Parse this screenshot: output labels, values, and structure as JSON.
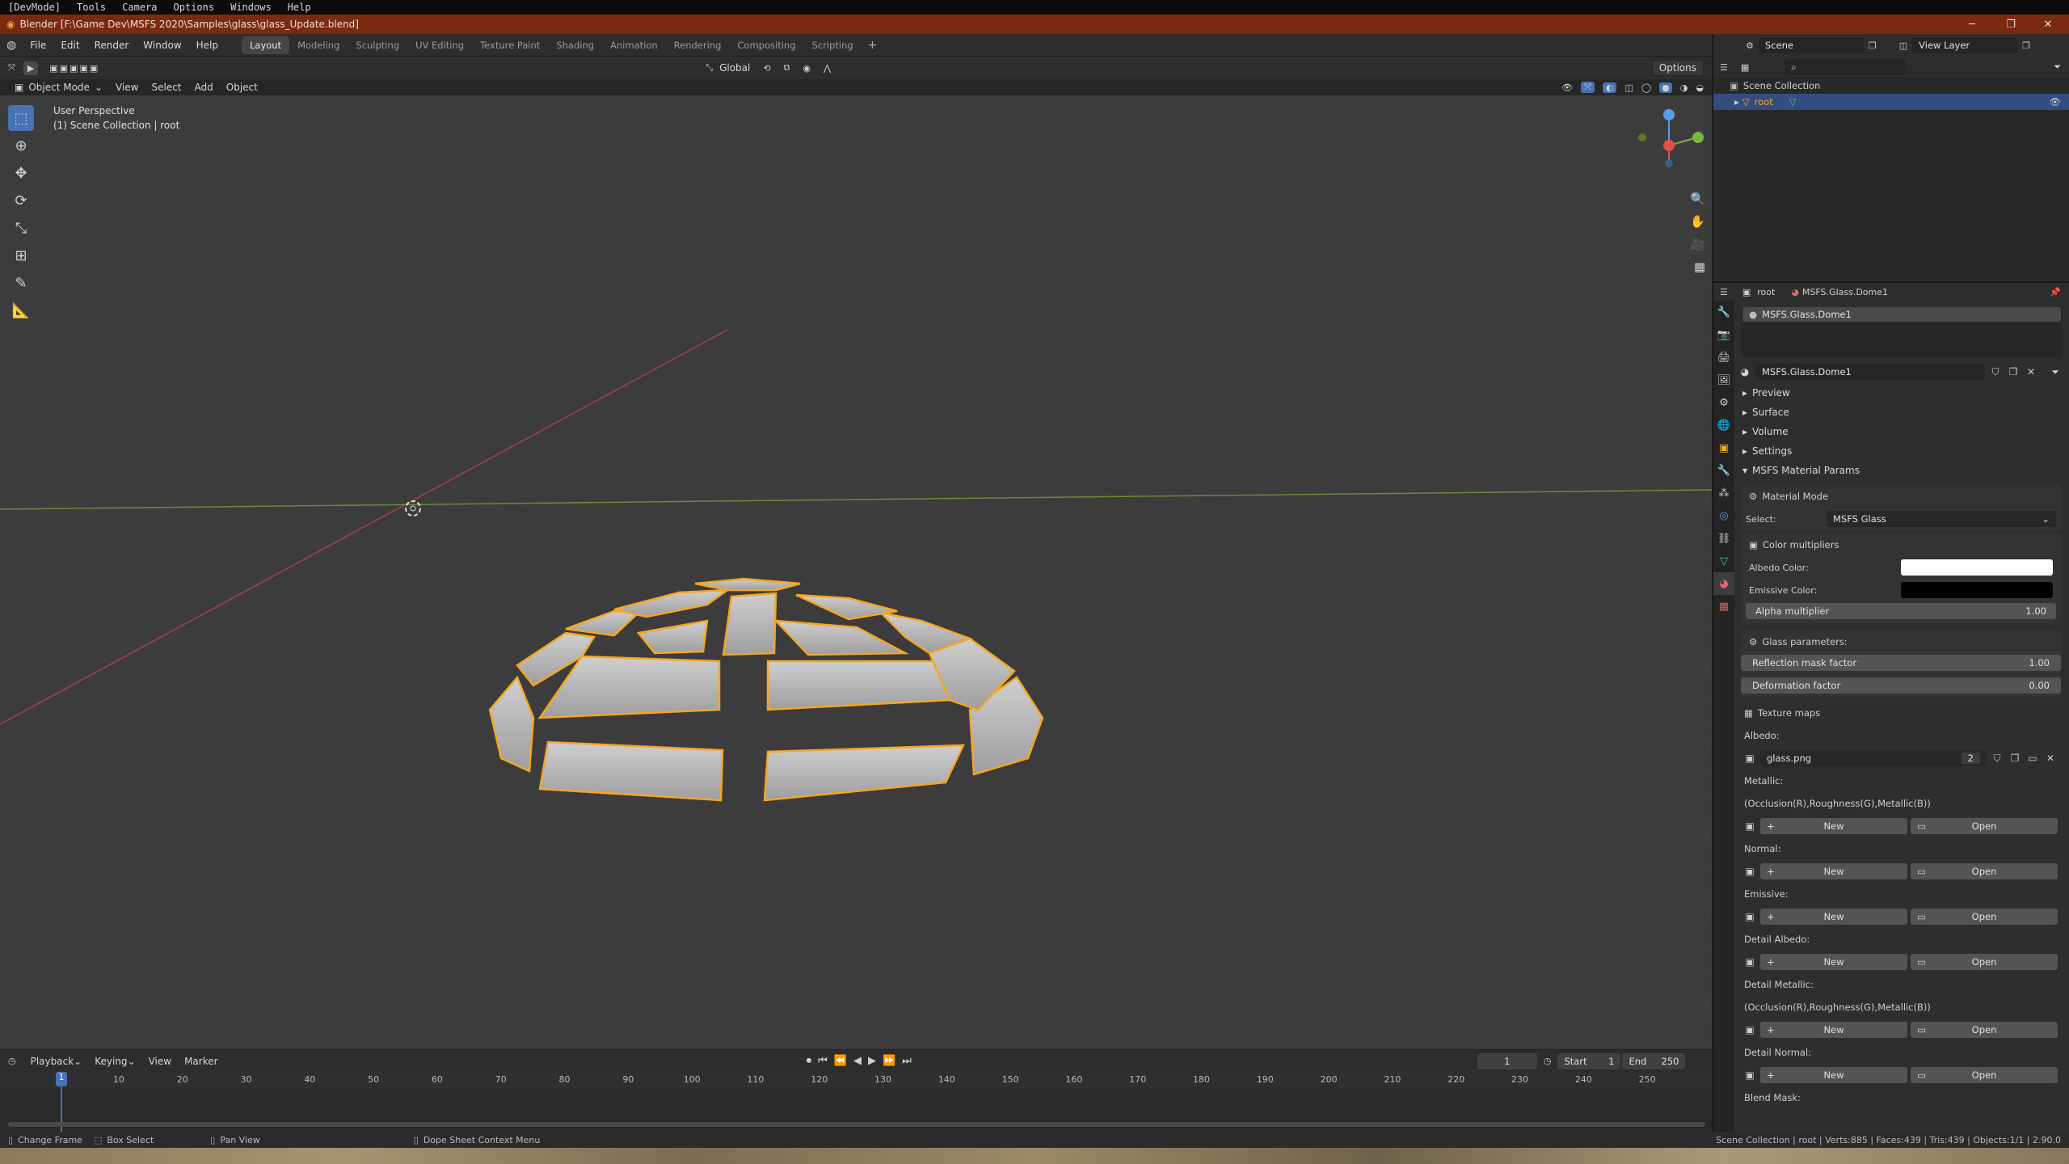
{
  "sys_menu": [
    "[DevMode]",
    "Tools",
    "Camera",
    "Options",
    "Windows",
    "Help"
  ],
  "title": "Blender [F:\\Game Dev\\MSFS 2020\\Samples\\glass\\glass_Update.blend]",
  "window_controls": {
    "minimize": "─",
    "restore": "❐",
    "close": "✕"
  },
  "menu": [
    "File",
    "Edit",
    "Render",
    "Window",
    "Help"
  ],
  "workspaces": [
    "Layout",
    "Modeling",
    "Sculpting",
    "UV Editing",
    "Texture Paint",
    "Shading",
    "Animation",
    "Rendering",
    "Compositing",
    "Scripting"
  ],
  "active_workspace": "Layout",
  "scene": {
    "label": "Scene",
    "view_layer": "View Layer"
  },
  "viewport": {
    "mode": "Object Mode",
    "menus": [
      "View",
      "Select",
      "Add",
      "Object"
    ],
    "orientation": "Global",
    "options": "Options",
    "perspective": "User Perspective",
    "collection": "(1) Scene Collection | root"
  },
  "outliner": {
    "scene_collection": "Scene Collection",
    "root": "root"
  },
  "properties": {
    "breadcrumb_object": "root",
    "breadcrumb_material": "MSFS.Glass.Dome1",
    "slot": "MSFS.Glass.Dome1",
    "material_name": "MSFS.Glass.Dome1",
    "panels": [
      "Preview",
      "Surface",
      "Volume",
      "Settings"
    ],
    "msfs_panel": "MSFS Material Params",
    "material_mode": "Material Mode",
    "select_label": "Select:",
    "select_value": "MSFS Glass",
    "color_multipliers": "Color multipliers",
    "albedo_color_label": "Albedo Color:",
    "albedo_color": "#ffffff",
    "emissive_color_label": "Emissive Color:",
    "emissive_color": "#000000",
    "alpha_label": "Alpha multiplier",
    "alpha_value": "1.00",
    "glass_params": "Glass parameters:",
    "reflection_label": "Reflection mask factor",
    "reflection_value": "1.00",
    "deformation_label": "Deformation factor",
    "deformation_value": "0.00",
    "texture_maps": "Texture maps",
    "albedo_label": "Albedo:",
    "albedo_texture": "glass.png",
    "albedo_users": "2",
    "metallic_label": "Metallic:",
    "metallic_note": "(Occlusion(R),Roughness(G),Metallic(B))",
    "normal_label": "Normal:",
    "emissive_label": "Emissive:",
    "detail_albedo_label": "Detail Albedo:",
    "detail_metallic_label": "Detail Metallic:",
    "detail_metallic_note": "(Occlusion(R),Roughness(G),Metallic(B))",
    "detail_normal_label": "Detail Normal:",
    "blend_mask_label": "Blend Mask:",
    "new_label": "New",
    "open_label": "Open"
  },
  "timeline": {
    "menus": [
      "Playback",
      "Keying",
      "View",
      "Marker"
    ],
    "current_frame": "1",
    "start_label": "Start",
    "start": "1",
    "end_label": "End",
    "end": "250",
    "ticks": [
      "1",
      "10",
      "20",
      "30",
      "40",
      "50",
      "60",
      "70",
      "80",
      "90",
      "100",
      "110",
      "120",
      "130",
      "140",
      "150",
      "160",
      "170",
      "180",
      "190",
      "200",
      "210",
      "220",
      "230",
      "240",
      "250"
    ]
  },
  "status": {
    "change_frame": "Change Frame",
    "box_select": "Box Select",
    "pan_view": "Pan View",
    "context_menu": "Dope Sheet Context Menu",
    "stats": "Scene Collection | root | Verts:885 | Faces:439 | Tris:439 | Objects:1/1 | 2.90.0"
  },
  "colors": {
    "accent": "#4772b3",
    "selection": "#f5a623",
    "titlebar": "#7a2a10"
  }
}
